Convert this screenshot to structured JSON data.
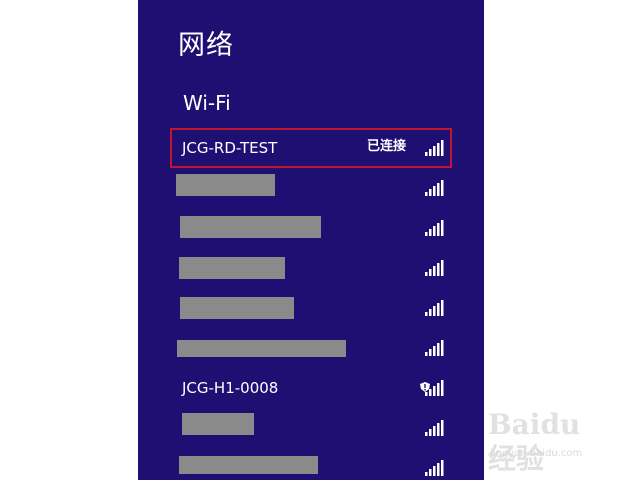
{
  "panel": {
    "title": "网络",
    "section_title": "Wi-Fi",
    "background_color": "#200f73",
    "selection_color": "#c0152f",
    "networks": [
      {
        "name": "JCG-RD-TEST",
        "status": "已连接",
        "redacted": false,
        "secured_warning": false,
        "signal_icon": "wifi-signal-full-icon"
      },
      {
        "name": "",
        "status": "",
        "redacted": true,
        "secured_warning": false,
        "signal_icon": "wifi-signal-full-icon"
      },
      {
        "name": "",
        "status": "",
        "redacted": true,
        "secured_warning": false,
        "signal_icon": "wifi-signal-full-icon"
      },
      {
        "name": "",
        "status": "",
        "redacted": true,
        "secured_warning": false,
        "signal_icon": "wifi-signal-full-icon"
      },
      {
        "name": "",
        "status": "",
        "redacted": true,
        "secured_warning": false,
        "signal_icon": "wifi-signal-full-icon"
      },
      {
        "name": "",
        "status": "",
        "redacted": true,
        "secured_warning": false,
        "signal_icon": "wifi-signal-full-icon"
      },
      {
        "name": "JCG-H1-0008",
        "status": "",
        "redacted": false,
        "secured_warning": true,
        "signal_icon": "wifi-signal-warning-icon"
      },
      {
        "name": "",
        "status": "",
        "redacted": true,
        "secured_warning": false,
        "signal_icon": "wifi-signal-full-icon"
      },
      {
        "name": "",
        "status": "",
        "redacted": true,
        "secured_warning": false,
        "signal_icon": "wifi-signal-full-icon"
      }
    ]
  },
  "watermark": {
    "brand": "Baidu 经验",
    "url": "jingyan.baidu.com"
  }
}
